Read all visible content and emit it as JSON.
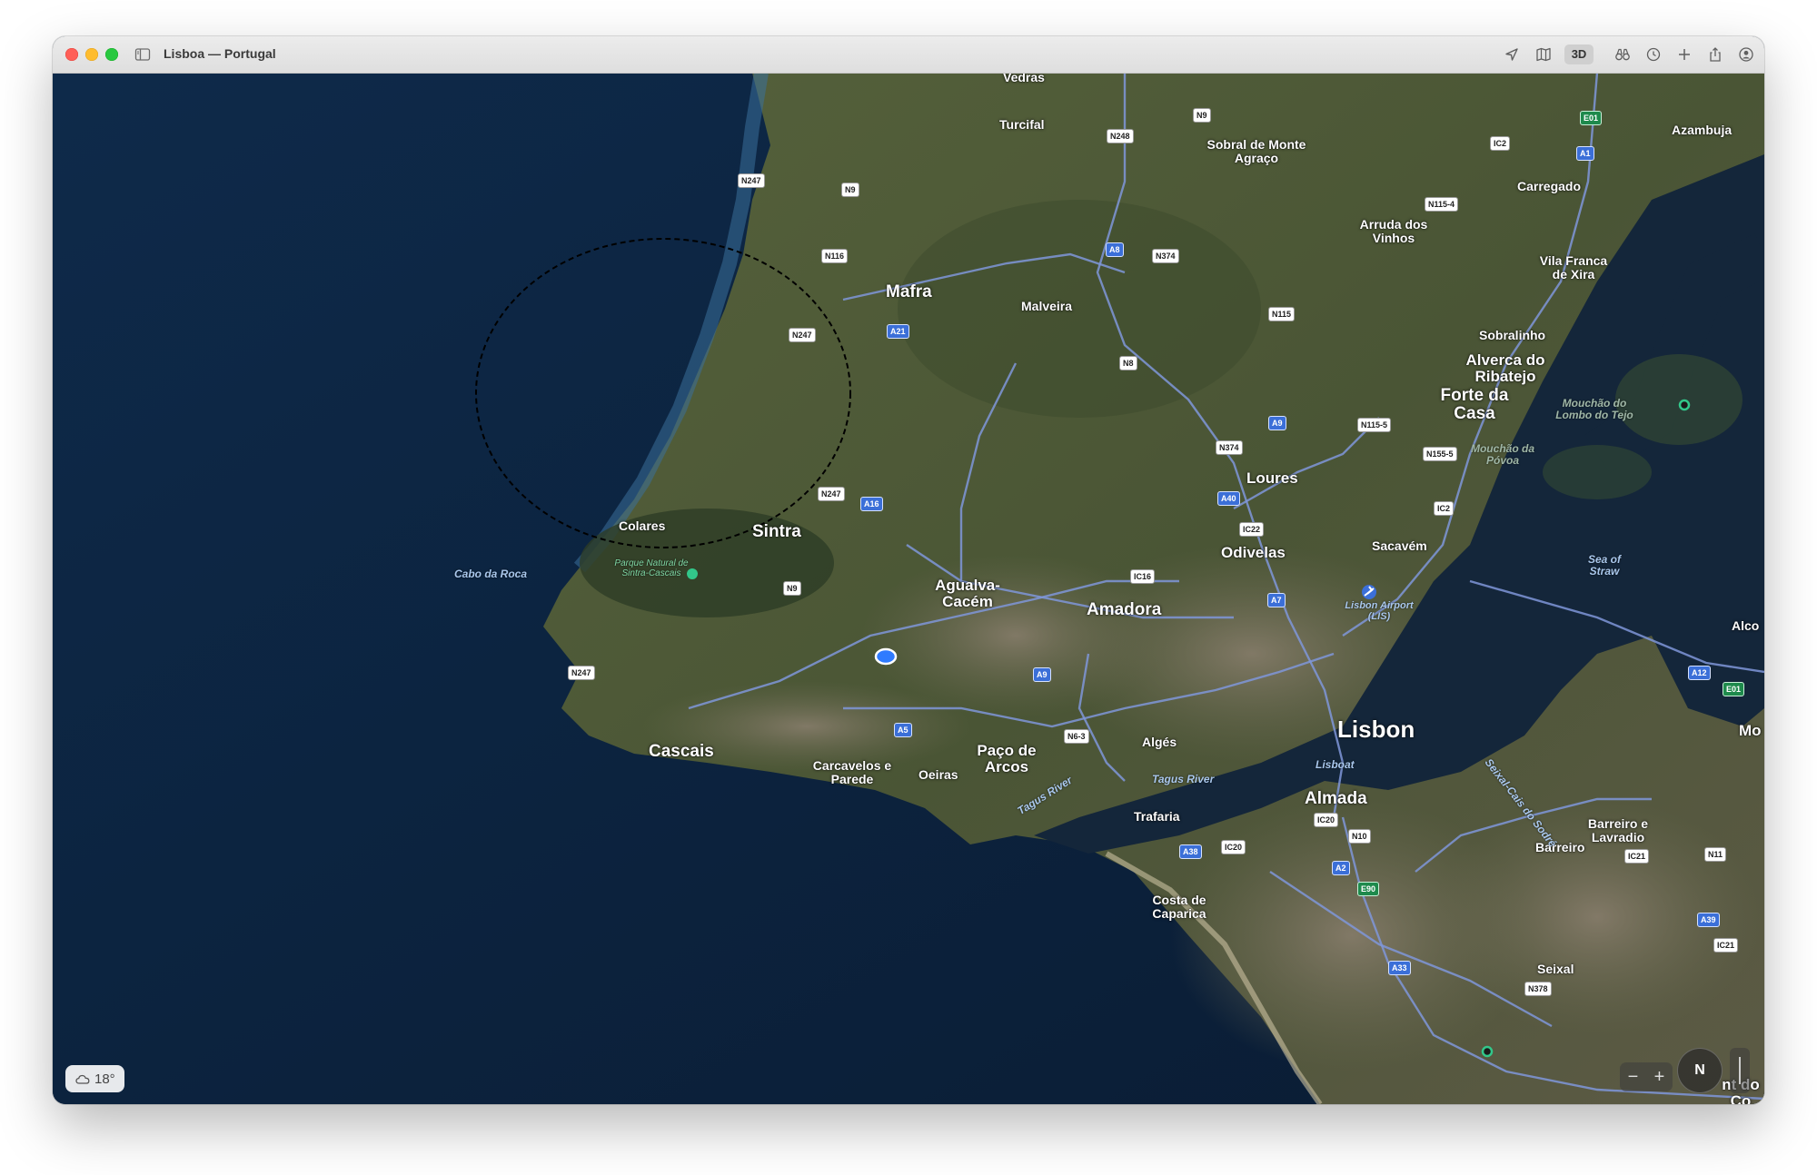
{
  "window": {
    "title": "Lisboa — Portugal"
  },
  "toolbar": {
    "icons": [
      "location-arrow-icon",
      "map-icon",
      "binoculars-icon",
      "clock-rotate-icon",
      "plus-icon",
      "share-icon",
      "account-icon"
    ],
    "view_3d_label": "3D"
  },
  "map": {
    "places": {
      "vedras": "Vedras",
      "turcifal": "Turcifal",
      "sobral": "Sobral de Monte Agraço",
      "azambuja": "Azambuja",
      "carregado": "Carregado",
      "arruda": "Arruda dos Vinhos",
      "vila_franca": "Vila Franca de Xira",
      "mafra": "Mafra",
      "malveira": "Malveira",
      "sobralinho": "Sobralinho",
      "alverca": "Alverca do Ribatejo",
      "forte": "Forte da Casa",
      "loures": "Loures",
      "colares": "Colares",
      "sintra": "Sintra",
      "odivelas": "Odivelas",
      "sacavem": "Sacavém",
      "agualva": "Agualva-Cacém",
      "amadora": "Amadora",
      "alcochete": "Alco",
      "cascais": "Cascais",
      "carcavelos": "Carcavelos e Parede",
      "oeiras": "Oeiras",
      "paco": "Paço de Arcos",
      "alges": "Algés",
      "lisbon": "Lisbon",
      "montijo": "Mo",
      "almada": "Almada",
      "trafaria": "Trafaria",
      "barreiro_lavradio": "Barreiro e Lavradio",
      "barreiro": "Barreiro",
      "costa": "Costa de Caparica",
      "seixal": "Seixal",
      "corroios": "nt do Co"
    },
    "water": {
      "cabo_roca": "Cabo da Roca",
      "sea_straw": "Sea of Straw",
      "tagus1": "Tagus River",
      "tagus2": "Tagus River",
      "lisboat": "Lisboat",
      "seixal_ferry": "Seixal-Cais do Sodré"
    },
    "marsh": {
      "mouchao_lombo": "Mouchão do Lombo do Tejo",
      "mouchao_povoa": "Mouchão da Póvoa"
    },
    "park": "Parque Natural de Sintra-Cascais",
    "airport": "Lisbon Airport (LIS)",
    "roads": {
      "n248": "N248",
      "n9a": "N9",
      "ic2a": "IC2",
      "e01a": "E01",
      "a1": "A1",
      "n247a": "N247",
      "n9b": "N9",
      "n1154": "N115-4",
      "n116": "N116",
      "a8": "A8",
      "n374a": "N374",
      "a21": "A21",
      "n247b": "N247",
      "n115": "N115",
      "n8": "N8",
      "a9a": "A9",
      "n1155": "N115-5",
      "n374b": "N374",
      "n1555": "N155-5",
      "n247c": "N247",
      "a16": "A16",
      "a40": "A40",
      "ic2b": "IC2",
      "ic22": "IC22",
      "ic16": "IC16",
      "n9c": "N9",
      "a7": "A7",
      "a12": "A12",
      "e01b": "E01",
      "n247d": "N247",
      "a9b": "A9",
      "a5": "A5",
      "n63": "N6-3",
      "ic20a": "IC20",
      "n10": "N10",
      "a38": "A38",
      "ic20b": "IC20",
      "a2": "A2",
      "e90": "E90",
      "ic21a": "IC21",
      "n11": "N11",
      "a39": "A39",
      "ic21b": "IC21",
      "a33": "A33",
      "n378": "N378"
    }
  },
  "weather": {
    "icon": "cloud-icon",
    "temperature": "18°"
  },
  "controls": {
    "zoom_out": "−",
    "zoom_in": "+",
    "compass": "N"
  }
}
